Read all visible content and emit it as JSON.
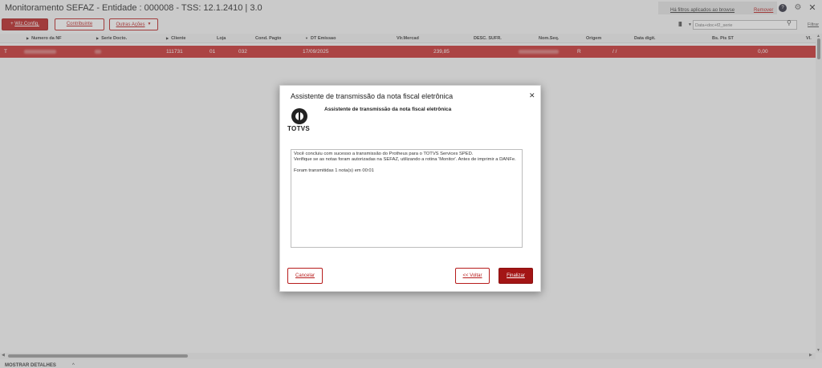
{
  "window": {
    "title": "Monitoramento SEFAZ - Entidade : 000008 - TSS: 12.1.2410 | 3.0",
    "filter_message": "Há filtros aplicados ao browse",
    "remove_label": "Remover"
  },
  "toolbar": {
    "wiz_plus": "+",
    "wiz_label": "Wiz.Config.",
    "contribuinte_label": "Contribuinte",
    "outras_label": "Outras Ações",
    "search_placeholder": "Data+doc+f2_serie",
    "filter_label": "Filtrar"
  },
  "grid": {
    "columns": [
      "Numero da NF",
      "Serie Docto.",
      "Cliente",
      "Loja",
      "Cond. Pagto",
      "DT Emissao",
      "Vlr.Mercad",
      "DESC. SUFR.",
      "Nom.Seq.",
      "Origem",
      "Data digit.",
      "Bs. Pis ST",
      "Vl."
    ],
    "row": {
      "indicator": "T",
      "cliente": "111731",
      "loja": "01",
      "cond_pagto": "032",
      "dt_emissao": "17/09/2025",
      "vlr_mercad": "239,85",
      "origem": "R",
      "data_digit": "/ /",
      "bs_pis_st": "0,00"
    }
  },
  "footer": {
    "label": "MOSTRAR DETALHES"
  },
  "dialog": {
    "title": "Assistente de transmissão da nota fiscal eletrônica",
    "heading": "Assistente de transmissão da nota fiscal eletrônica",
    "logo_text": "TOTVS",
    "message_lines": [
      "Você concluiu com sucesso a transmissão do Protheus para o TOTVS Services SPED.",
      "Verifique se as notas foram autorizadas na SEFAZ, utilizando a rotina 'Monitor'. Antes de imprimir a DANFe.",
      "Foram transmitidas 1 nota(s) em 00:01"
    ],
    "cancel_label": "Cancelar",
    "back_label": "<< Voltar",
    "finish_label": "Finalizar"
  },
  "colors": {
    "accent": "#b71c1c",
    "selected_row": "#c62828"
  }
}
